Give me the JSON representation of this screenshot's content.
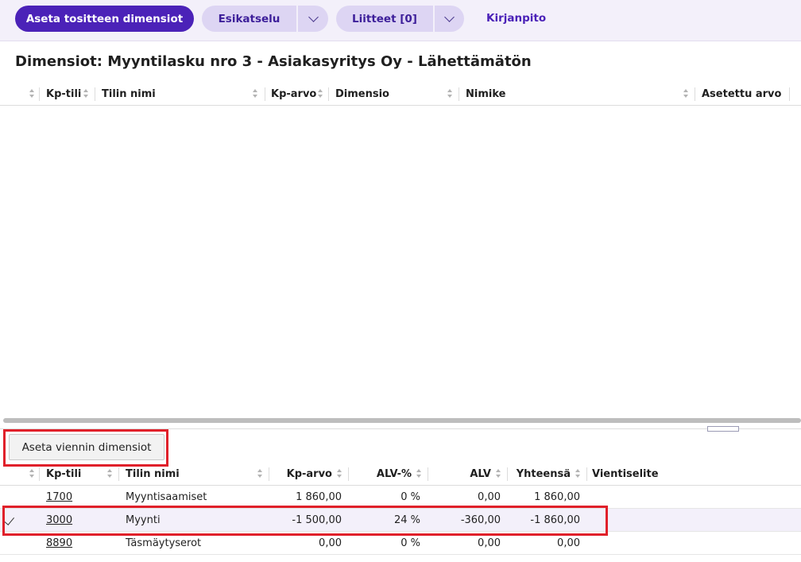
{
  "toolbar": {
    "set_doc_dims_label": "Aseta tositteen dimensiot",
    "preview_label": "Esikatselu",
    "attachments_label": "Liitteet [0]",
    "bookkeeping_label": "Kirjanpito"
  },
  "page_title": "Dimensiot: Myyntilasku nro 3 - Asiakasyritys Oy - Lähettämätön",
  "dim_grid": {
    "headers": {
      "kp_tili": "Kp-tili",
      "tilin_nimi": "Tilin nimi",
      "kp_arvo": "Kp-arvo",
      "dimensio": "Dimensio",
      "nimike": "Nimike",
      "asetettu_arvo": "Asetettu arvo"
    }
  },
  "set_line_dims_label": "Aseta viennin dimensiot",
  "lines_grid": {
    "headers": {
      "kp_tili": "Kp-tili",
      "tilin_nimi": "Tilin nimi",
      "kp_arvo": "Kp-arvo",
      "alv_pct": "ALV-%",
      "alv": "ALV",
      "yhteensa": "Yhteensä",
      "vientiselite": "Vientiselite"
    },
    "rows": [
      {
        "kp_tili": "1700",
        "tilin_nimi": "Myyntisaamiset",
        "kp_arvo": "1 860,00",
        "alv_pct": "0 %",
        "alv": "0,00",
        "yhteensa": "1 860,00",
        "vientiselite": ""
      },
      {
        "kp_tili": "3000",
        "tilin_nimi": "Myynti",
        "kp_arvo": "-1 500,00",
        "alv_pct": "24 %",
        "alv": "-360,00",
        "yhteensa": "-1 860,00",
        "vientiselite": ""
      },
      {
        "kp_tili": "8890",
        "tilin_nimi": "Täsmäytyserot",
        "kp_arvo": "0,00",
        "alv_pct": "0 %",
        "alv": "0,00",
        "yhteensa": "0,00",
        "vientiselite": ""
      }
    ]
  },
  "icons": {
    "dropdown": "chevron-down-icon",
    "sort": "sort-icon",
    "selected": "checkmark-icon"
  },
  "colors": {
    "primary": "#4b22b8",
    "secondary_button": "#ddd5f3",
    "toolbar_bg": "#f3f0fa",
    "highlight": "#e0202a"
  }
}
